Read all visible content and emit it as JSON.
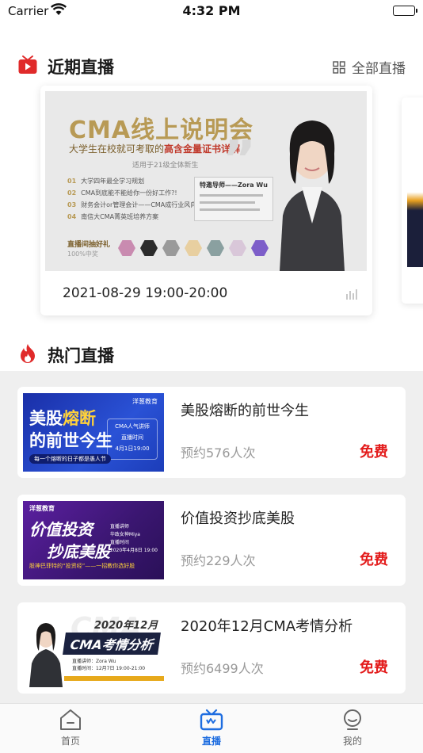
{
  "status_bar": {
    "carrier": "Carrier",
    "time": "4:32 PM"
  },
  "recent": {
    "title": "近期直播",
    "all_label": "全部直播",
    "card": {
      "poster_title": "CMA线上说明会",
      "poster_subtitle_prefix": "大学生在校就可考取的",
      "poster_subtitle_highlight": "高含金量证书详解",
      "poster_note": "适用于21级全体新生",
      "agenda": [
        {
          "num": "01",
          "text": "大学四年最全学习规划"
        },
        {
          "num": "02",
          "text": "CMA到底能不能给你一份好工作?!"
        },
        {
          "num": "03",
          "text": "财务会计or管理会计——CMA成行业风向标"
        },
        {
          "num": "04",
          "text": "南信大CMA菁英班培养方案"
        }
      ],
      "teacher": "特邀导师——Zora Wu",
      "gift_title": "直播间抽好礼",
      "gift_note": "100%中奖",
      "time": "2021-08-29 19:00-20:00"
    }
  },
  "hot": {
    "title": "热门直播",
    "items": [
      {
        "title": "美股熔断的前世今生",
        "count": "预约576人次",
        "price": "免费",
        "thumb": {
          "line1_a": "美股",
          "line1_b": "熔断",
          "line2": "的前世今生",
          "brand": "洋葱教育",
          "tag": "每一个熔断的日子都是愚人节",
          "info_title": "CMA人气讲师",
          "info_time_label": "直播时间",
          "info_time": "4月1日19:00"
        }
      },
      {
        "title": "价值投资抄底美股",
        "count": "预约229人次",
        "price": "免费",
        "thumb": {
          "brand": "洋葱教育",
          "line1": "价值投资",
          "line2": "抄底美股",
          "caption": "股神巴菲特的“投资经”——一招教你选好股",
          "info_lines": [
            "直播讲师",
            "华政女神Miya",
            "直播时间",
            "2020年4月8日 19:00"
          ]
        }
      },
      {
        "title": "2020年12月CMA考情分析",
        "count": "预约6499人次",
        "price": "免费",
        "thumb": {
          "bg": "CMA",
          "year": "2020年12月",
          "banner": "CMA考情分析",
          "info_lines": [
            "直播讲师：Zora Wu",
            "直播时间：12月7日 19:00-21:00"
          ]
        }
      }
    ]
  },
  "tabs": [
    {
      "label": "首页",
      "icon": "home-icon",
      "active": false
    },
    {
      "label": "直播",
      "icon": "tv-icon",
      "active": true
    },
    {
      "label": "我的",
      "icon": "profile-icon",
      "active": false
    }
  ],
  "colors": {
    "accent": "#1e6de0",
    "price": "#e31b1b",
    "section_icon": "#e02a2a"
  }
}
